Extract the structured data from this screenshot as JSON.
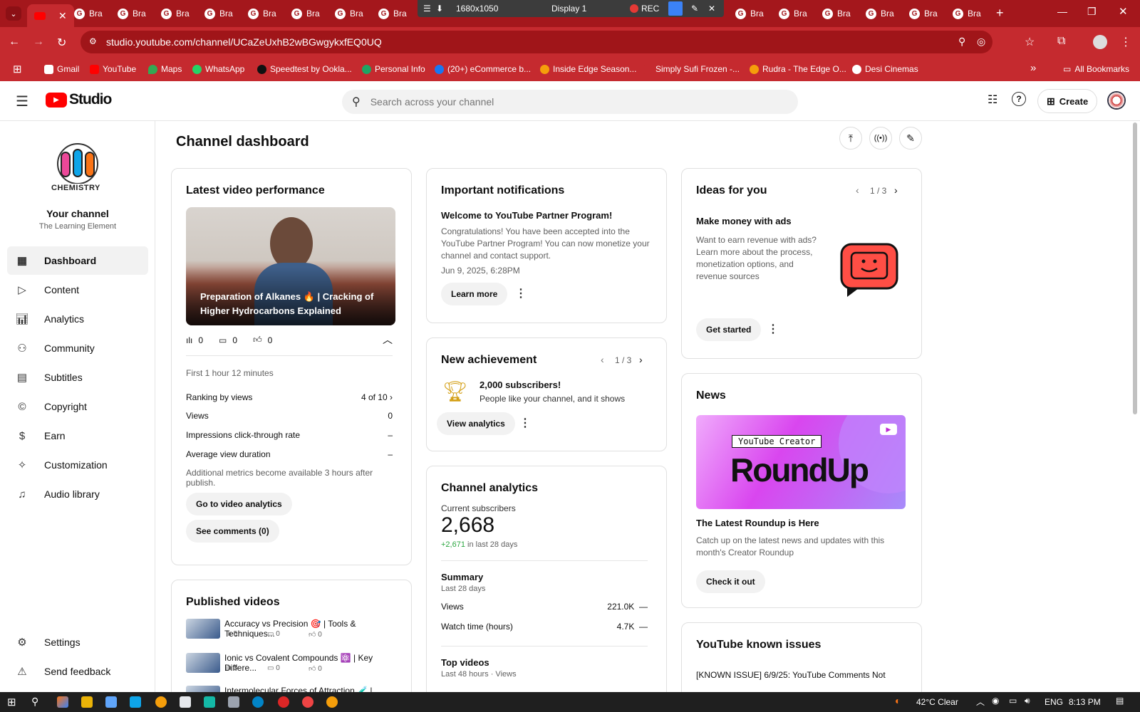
{
  "browser": {
    "active_tab_title": "",
    "other_tab_label": "Bra",
    "recording": {
      "resolution": "1680x1050",
      "display": "Display 1",
      "rec_label": "REC"
    },
    "url": "studio.youtube.com/channel/UCaZeUxhB2wBGwgykxfEQ0UQ",
    "bookmarks": [
      "Gmail",
      "YouTube",
      "Maps",
      "WhatsApp",
      "Speedtest by Ookla...",
      "Personal Info",
      "(20+) eCommerce b...",
      "Inside Edge Season...",
      "Simply Sufi Frozen -...",
      "Rudra - The Edge O...",
      "Desi Cinemas"
    ],
    "bookmarks_more": "»",
    "all_bookmarks": "All Bookmarks"
  },
  "header": {
    "logo_text": "Studio",
    "search_placeholder": "Search across your channel",
    "create_label": "Create"
  },
  "sidebar": {
    "channel_logo_text": "CHEMISTRY",
    "channel_title": "Your channel",
    "channel_name": "The Learning Element",
    "items": [
      {
        "label": "Dashboard"
      },
      {
        "label": "Content"
      },
      {
        "label": "Analytics"
      },
      {
        "label": "Community"
      },
      {
        "label": "Subtitles"
      },
      {
        "label": "Copyright"
      },
      {
        "label": "Earn"
      },
      {
        "label": "Customization"
      },
      {
        "label": "Audio library"
      }
    ],
    "settings_label": "Settings",
    "feedback_label": "Send feedback"
  },
  "dashboard": {
    "title": "Channel dashboard",
    "latest": {
      "title": "Latest video performance",
      "video_title": "Preparation of Alkanes 🔥 | Cracking of Higher Hydrocarbons Explained",
      "views": "0",
      "comments": "0",
      "likes": "0",
      "period": "First 1 hour 12 minutes",
      "metrics": [
        {
          "label": "Ranking by views",
          "value": "4 of 10"
        },
        {
          "label": "Views",
          "value": "0"
        },
        {
          "label": "Impressions click-through rate",
          "value": "–"
        },
        {
          "label": "Average view duration",
          "value": "–"
        }
      ],
      "note": "Additional metrics become available 3 hours after publish.",
      "btn_analytics": "Go to video analytics",
      "btn_comments": "See comments (0)"
    },
    "published": {
      "title": "Published videos",
      "videos": [
        {
          "title": "Accuracy vs Precision 🎯 | Tools & Techniques...",
          "views": "5",
          "comments": "0",
          "likes": "0"
        },
        {
          "title": "Ionic vs Covalent Compounds ⚛️ | Key Differe...",
          "views": "3",
          "comments": "0",
          "likes": "0"
        },
        {
          "title": "Intermolecular Forces of Attraction 🧪 | Types...",
          "views": "",
          "comments": "",
          "likes": ""
        }
      ]
    },
    "notifications": {
      "title": "Important notifications",
      "headline": "Welcome to YouTube Partner Program!",
      "body": "Congratulations! You have been accepted into the YouTube Partner Program! You can now monetize your channel and contact support.",
      "date": "Jun 9, 2025, 6:28PM",
      "btn": "Learn more"
    },
    "achievement": {
      "title": "New achievement",
      "pager": "1 / 3",
      "headline": "2,000 subscribers!",
      "sub": "People like your channel, and it shows",
      "btn": "View analytics"
    },
    "analytics": {
      "title": "Channel analytics",
      "subs_label": "Current subscribers",
      "subs_value": "2,668",
      "subs_delta": "+2,671",
      "subs_delta_suffix": "in last 28 days",
      "summary_title": "Summary",
      "summary_period": "Last 28 days",
      "rows": [
        {
          "label": "Views",
          "value": "221.0K",
          "trend": "—"
        },
        {
          "label": "Watch time (hours)",
          "value": "4.7K",
          "trend": "—"
        }
      ],
      "top_title": "Top videos",
      "top_period": "Last 48 hours · Views"
    },
    "ideas": {
      "title": "Ideas for you",
      "pager": "1 / 3",
      "headline": "Make money with ads",
      "body": "Want to earn revenue with ads? Learn more about the process, monetization options, and revenue sources",
      "btn": "Get started"
    },
    "news": {
      "title": "News",
      "banner_small": "YouTube Creator",
      "banner_big": "RoundUp",
      "headline": "The Latest Roundup is Here",
      "body": "Catch up on the latest news and updates with this month's Creator Roundup",
      "btn": "Check it out"
    },
    "issues": {
      "title": "YouTube known issues",
      "item": "[KNOWN ISSUE] 6/9/25: YouTube Comments Not"
    }
  },
  "taskbar": {
    "weather": "42°C  Clear",
    "lang": "ENG",
    "time": "8:13 PM"
  },
  "colors": {
    "brand_red": "#ff0000",
    "chrome_red": "#c52a2f",
    "positive_green": "#2ba640"
  }
}
